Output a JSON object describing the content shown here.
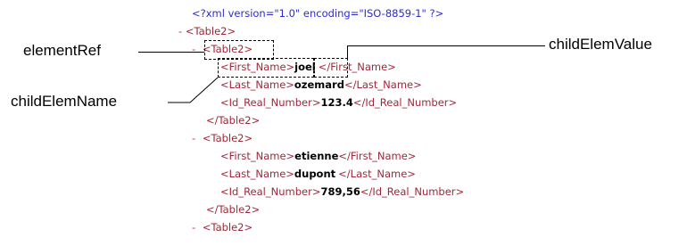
{
  "xml": {
    "declaration": "<?xml version=\"1.0\" encoding=\"ISO-8859-1\" ?>",
    "toggle": "-",
    "root_open": "<Table2>",
    "row_open": "<Table2>",
    "row_close": "</Table2>",
    "rows": [
      {
        "first_open": "<First_Name>",
        "first_value": "joel",
        "first_close": "</First_Name>",
        "last_open": "<Last_Name>",
        "last_value": "ozemard",
        "last_close": "</Last_Name>",
        "id_open": "<Id_Real_Number>",
        "id_value": "123.4",
        "id_close": "</Id_Real_Number>"
      },
      {
        "first_open": "<First_Name>",
        "first_value": "etienne",
        "first_close": "</First_Name>",
        "last_open": "<Last_Name>",
        "last_value": "dupont",
        "last_close": "</Last_Name>",
        "id_open": "<Id_Real_Number>",
        "id_value": "789,56",
        "id_close": "</Id_Real_Number>"
      }
    ]
  },
  "callouts": {
    "element_ref": "elementRef",
    "child_elem_value": "childElemValue",
    "child_elem_name": "childElemName"
  }
}
